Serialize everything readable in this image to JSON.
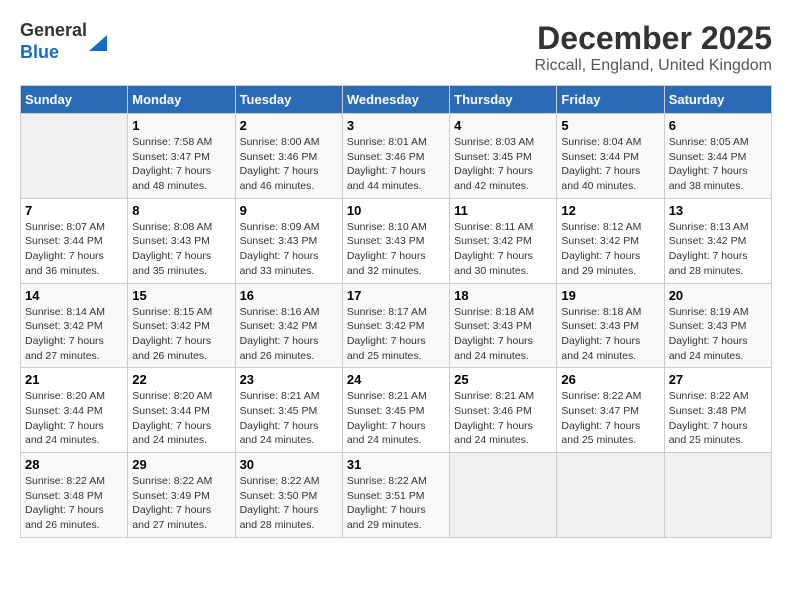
{
  "logo": {
    "line1": "General",
    "line2": "Blue"
  },
  "title": "December 2025",
  "location": "Riccall, England, United Kingdom",
  "weekdays": [
    "Sunday",
    "Monday",
    "Tuesday",
    "Wednesday",
    "Thursday",
    "Friday",
    "Saturday"
  ],
  "weeks": [
    [
      {
        "day": "",
        "sunrise": "",
        "sunset": "",
        "daylight": ""
      },
      {
        "day": "1",
        "sunrise": "Sunrise: 7:58 AM",
        "sunset": "Sunset: 3:47 PM",
        "daylight": "Daylight: 7 hours and 48 minutes."
      },
      {
        "day": "2",
        "sunrise": "Sunrise: 8:00 AM",
        "sunset": "Sunset: 3:46 PM",
        "daylight": "Daylight: 7 hours and 46 minutes."
      },
      {
        "day": "3",
        "sunrise": "Sunrise: 8:01 AM",
        "sunset": "Sunset: 3:46 PM",
        "daylight": "Daylight: 7 hours and 44 minutes."
      },
      {
        "day": "4",
        "sunrise": "Sunrise: 8:03 AM",
        "sunset": "Sunset: 3:45 PM",
        "daylight": "Daylight: 7 hours and 42 minutes."
      },
      {
        "day": "5",
        "sunrise": "Sunrise: 8:04 AM",
        "sunset": "Sunset: 3:44 PM",
        "daylight": "Daylight: 7 hours and 40 minutes."
      },
      {
        "day": "6",
        "sunrise": "Sunrise: 8:05 AM",
        "sunset": "Sunset: 3:44 PM",
        "daylight": "Daylight: 7 hours and 38 minutes."
      }
    ],
    [
      {
        "day": "7",
        "sunrise": "Sunrise: 8:07 AM",
        "sunset": "Sunset: 3:44 PM",
        "daylight": "Daylight: 7 hours and 36 minutes."
      },
      {
        "day": "8",
        "sunrise": "Sunrise: 8:08 AM",
        "sunset": "Sunset: 3:43 PM",
        "daylight": "Daylight: 7 hours and 35 minutes."
      },
      {
        "day": "9",
        "sunrise": "Sunrise: 8:09 AM",
        "sunset": "Sunset: 3:43 PM",
        "daylight": "Daylight: 7 hours and 33 minutes."
      },
      {
        "day": "10",
        "sunrise": "Sunrise: 8:10 AM",
        "sunset": "Sunset: 3:43 PM",
        "daylight": "Daylight: 7 hours and 32 minutes."
      },
      {
        "day": "11",
        "sunrise": "Sunrise: 8:11 AM",
        "sunset": "Sunset: 3:42 PM",
        "daylight": "Daylight: 7 hours and 30 minutes."
      },
      {
        "day": "12",
        "sunrise": "Sunrise: 8:12 AM",
        "sunset": "Sunset: 3:42 PM",
        "daylight": "Daylight: 7 hours and 29 minutes."
      },
      {
        "day": "13",
        "sunrise": "Sunrise: 8:13 AM",
        "sunset": "Sunset: 3:42 PM",
        "daylight": "Daylight: 7 hours and 28 minutes."
      }
    ],
    [
      {
        "day": "14",
        "sunrise": "Sunrise: 8:14 AM",
        "sunset": "Sunset: 3:42 PM",
        "daylight": "Daylight: 7 hours and 27 minutes."
      },
      {
        "day": "15",
        "sunrise": "Sunrise: 8:15 AM",
        "sunset": "Sunset: 3:42 PM",
        "daylight": "Daylight: 7 hours and 26 minutes."
      },
      {
        "day": "16",
        "sunrise": "Sunrise: 8:16 AM",
        "sunset": "Sunset: 3:42 PM",
        "daylight": "Daylight: 7 hours and 26 minutes."
      },
      {
        "day": "17",
        "sunrise": "Sunrise: 8:17 AM",
        "sunset": "Sunset: 3:42 PM",
        "daylight": "Daylight: 7 hours and 25 minutes."
      },
      {
        "day": "18",
        "sunrise": "Sunrise: 8:18 AM",
        "sunset": "Sunset: 3:43 PM",
        "daylight": "Daylight: 7 hours and 24 minutes."
      },
      {
        "day": "19",
        "sunrise": "Sunrise: 8:18 AM",
        "sunset": "Sunset: 3:43 PM",
        "daylight": "Daylight: 7 hours and 24 minutes."
      },
      {
        "day": "20",
        "sunrise": "Sunrise: 8:19 AM",
        "sunset": "Sunset: 3:43 PM",
        "daylight": "Daylight: 7 hours and 24 minutes."
      }
    ],
    [
      {
        "day": "21",
        "sunrise": "Sunrise: 8:20 AM",
        "sunset": "Sunset: 3:44 PM",
        "daylight": "Daylight: 7 hours and 24 minutes."
      },
      {
        "day": "22",
        "sunrise": "Sunrise: 8:20 AM",
        "sunset": "Sunset: 3:44 PM",
        "daylight": "Daylight: 7 hours and 24 minutes."
      },
      {
        "day": "23",
        "sunrise": "Sunrise: 8:21 AM",
        "sunset": "Sunset: 3:45 PM",
        "daylight": "Daylight: 7 hours and 24 minutes."
      },
      {
        "day": "24",
        "sunrise": "Sunrise: 8:21 AM",
        "sunset": "Sunset: 3:45 PM",
        "daylight": "Daylight: 7 hours and 24 minutes."
      },
      {
        "day": "25",
        "sunrise": "Sunrise: 8:21 AM",
        "sunset": "Sunset: 3:46 PM",
        "daylight": "Daylight: 7 hours and 24 minutes."
      },
      {
        "day": "26",
        "sunrise": "Sunrise: 8:22 AM",
        "sunset": "Sunset: 3:47 PM",
        "daylight": "Daylight: 7 hours and 25 minutes."
      },
      {
        "day": "27",
        "sunrise": "Sunrise: 8:22 AM",
        "sunset": "Sunset: 3:48 PM",
        "daylight": "Daylight: 7 hours and 25 minutes."
      }
    ],
    [
      {
        "day": "28",
        "sunrise": "Sunrise: 8:22 AM",
        "sunset": "Sunset: 3:48 PM",
        "daylight": "Daylight: 7 hours and 26 minutes."
      },
      {
        "day": "29",
        "sunrise": "Sunrise: 8:22 AM",
        "sunset": "Sunset: 3:49 PM",
        "daylight": "Daylight: 7 hours and 27 minutes."
      },
      {
        "day": "30",
        "sunrise": "Sunrise: 8:22 AM",
        "sunset": "Sunset: 3:50 PM",
        "daylight": "Daylight: 7 hours and 28 minutes."
      },
      {
        "day": "31",
        "sunrise": "Sunrise: 8:22 AM",
        "sunset": "Sunset: 3:51 PM",
        "daylight": "Daylight: 7 hours and 29 minutes."
      },
      {
        "day": "",
        "sunrise": "",
        "sunset": "",
        "daylight": ""
      },
      {
        "day": "",
        "sunrise": "",
        "sunset": "",
        "daylight": ""
      },
      {
        "day": "",
        "sunrise": "",
        "sunset": "",
        "daylight": ""
      }
    ]
  ]
}
